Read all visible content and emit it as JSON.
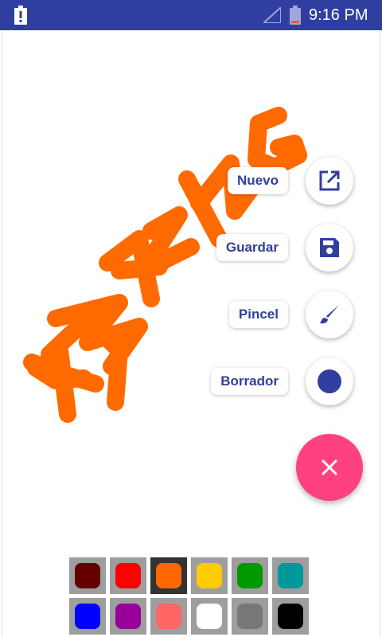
{
  "status_bar": {
    "time": "9:16 PM",
    "icons": [
      "alert-icon",
      "signal-icon",
      "battery-icon"
    ],
    "background": "#303f9f"
  },
  "speed_dial": {
    "items": [
      {
        "label": "Nuevo",
        "icon": "open-in-new-icon"
      },
      {
        "label": "Guardar",
        "icon": "save-icon"
      },
      {
        "label": "Pincel",
        "icon": "brush-icon"
      },
      {
        "label": "Borrador",
        "icon": "eraser-dot-icon"
      }
    ],
    "close_icon": "close-icon",
    "fab_color": "#ff4081",
    "icon_color": "#303f9f"
  },
  "drawing": {
    "text": "AMAZING",
    "stroke_color": "#ff6a00"
  },
  "palette": {
    "selected_index": 2,
    "colors": [
      "#660000",
      "#ff0000",
      "#ff6600",
      "#ffcc00",
      "#009900",
      "#009999",
      "#0000ff",
      "#990099",
      "#ff6666",
      "#ffffff",
      "#777777",
      "#000000"
    ]
  }
}
